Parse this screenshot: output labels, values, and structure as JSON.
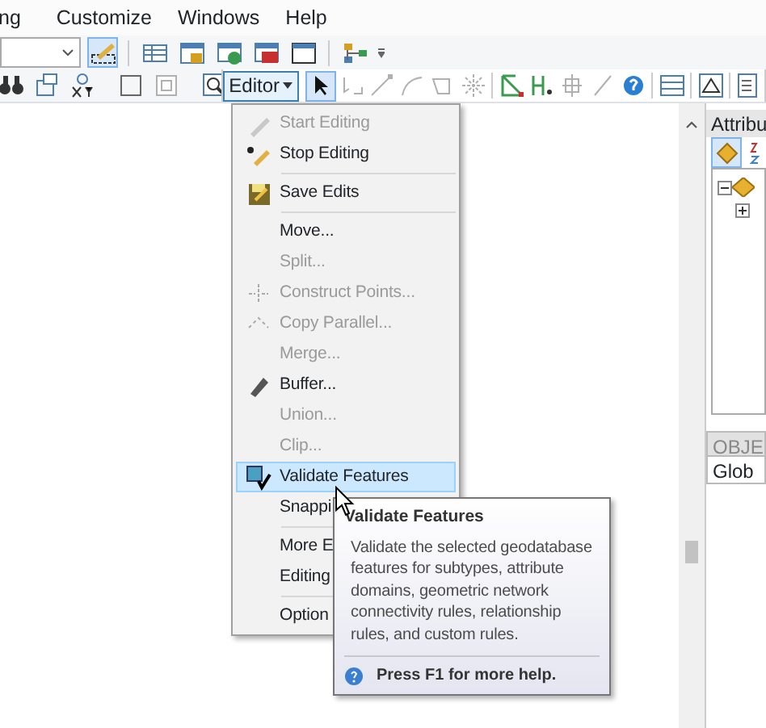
{
  "menu_bar": [
    "ng",
    "Customize",
    "Windows",
    "Help"
  ],
  "toolbar_row_1": [
    {
      "selected": true,
      "disabled": false
    },
    {
      "selected": false,
      "disabled": false
    },
    {
      "selected": false,
      "disabled": false
    },
    {
      "selected": false,
      "disabled": false
    },
    {
      "selected": false,
      "disabled": false
    },
    {
      "selected": false,
      "disabled": false
    },
    {
      "selected": false,
      "disabled": false
    }
  ],
  "toolbar_row_2": [
    {
      "selected": false,
      "disabled": false
    },
    {
      "selected": false,
      "disabled": false
    },
    {
      "selected": false,
      "disabled": false
    },
    {
      "selected": false,
      "disabled": false
    },
    {
      "selected": false,
      "disabled": true
    },
    {
      "selected": false,
      "disabled": false
    }
  ],
  "editor_toolbar": {
    "label": "Editor",
    "expanded": true,
    "buttons": [
      {
        "selected": true,
        "disabled": false
      },
      {
        "selected": false,
        "disabled": true
      },
      {
        "selected": false,
        "disabled": true
      },
      {
        "selected": false,
        "disabled": true
      },
      {
        "selected": false,
        "disabled": true
      },
      {
        "selected": false,
        "disabled": true
      },
      {
        "selected": false,
        "disabled": false
      },
      {
        "selected": false,
        "disabled": false
      },
      {
        "selected": false,
        "disabled": true
      },
      {
        "selected": false,
        "disabled": true
      },
      {
        "selected": false,
        "disabled": false
      },
      {
        "selected": false,
        "disabled": false
      },
      {
        "selected": false,
        "disabled": false
      },
      {
        "selected": false,
        "disabled": false
      }
    ]
  },
  "editor_menu": [
    {
      "kind": "item",
      "label": "Start Editing",
      "disabled": true,
      "selected": false
    },
    {
      "kind": "item",
      "label": "Stop Editing",
      "disabled": false,
      "selected": false
    },
    {
      "kind": "separator"
    },
    {
      "kind": "item",
      "label": "Save Edits",
      "disabled": false,
      "selected": false
    },
    {
      "kind": "separator"
    },
    {
      "kind": "item",
      "label": "Move...",
      "disabled": false,
      "selected": false
    },
    {
      "kind": "item",
      "label": "Split...",
      "disabled": true,
      "selected": false
    },
    {
      "kind": "item",
      "label": "Construct Points...",
      "disabled": true,
      "selected": false
    },
    {
      "kind": "item",
      "label": "Copy Parallel...",
      "disabled": true,
      "selected": false
    },
    {
      "kind": "item",
      "label": "Merge...",
      "disabled": true,
      "selected": false
    },
    {
      "kind": "item",
      "label": "Buffer...",
      "disabled": false,
      "selected": false
    },
    {
      "kind": "item",
      "label": "Union...",
      "disabled": true,
      "selected": false
    },
    {
      "kind": "item",
      "label": "Clip...",
      "disabled": true,
      "selected": false
    },
    {
      "kind": "item",
      "label": "Validate Features",
      "disabled": false,
      "selected": true
    },
    {
      "kind": "submenu",
      "label": "Snappi",
      "disabled": false,
      "selected": false
    },
    {
      "kind": "separator"
    },
    {
      "kind": "item",
      "label": "More E",
      "disabled": false,
      "selected": false
    },
    {
      "kind": "item",
      "label": "Editing",
      "disabled": false,
      "selected": false
    },
    {
      "kind": "separator"
    },
    {
      "kind": "item",
      "label": "Option",
      "disabled": false,
      "selected": false
    }
  ],
  "tooltip": {
    "title": "Validate Features",
    "body": "Validate the selected geodatabase features for subtypes, attribute domains, geometric network connectivity rules, relationship rules, and custom rules.",
    "help": "Press F1 for more help."
  },
  "attributes_panel": {
    "title": "Attribu",
    "tree": [
      {
        "expanded": true,
        "children": [
          {
            "expanded": false
          }
        ]
      }
    ],
    "table_header": "OBJE",
    "table_cell": "Glob"
  }
}
